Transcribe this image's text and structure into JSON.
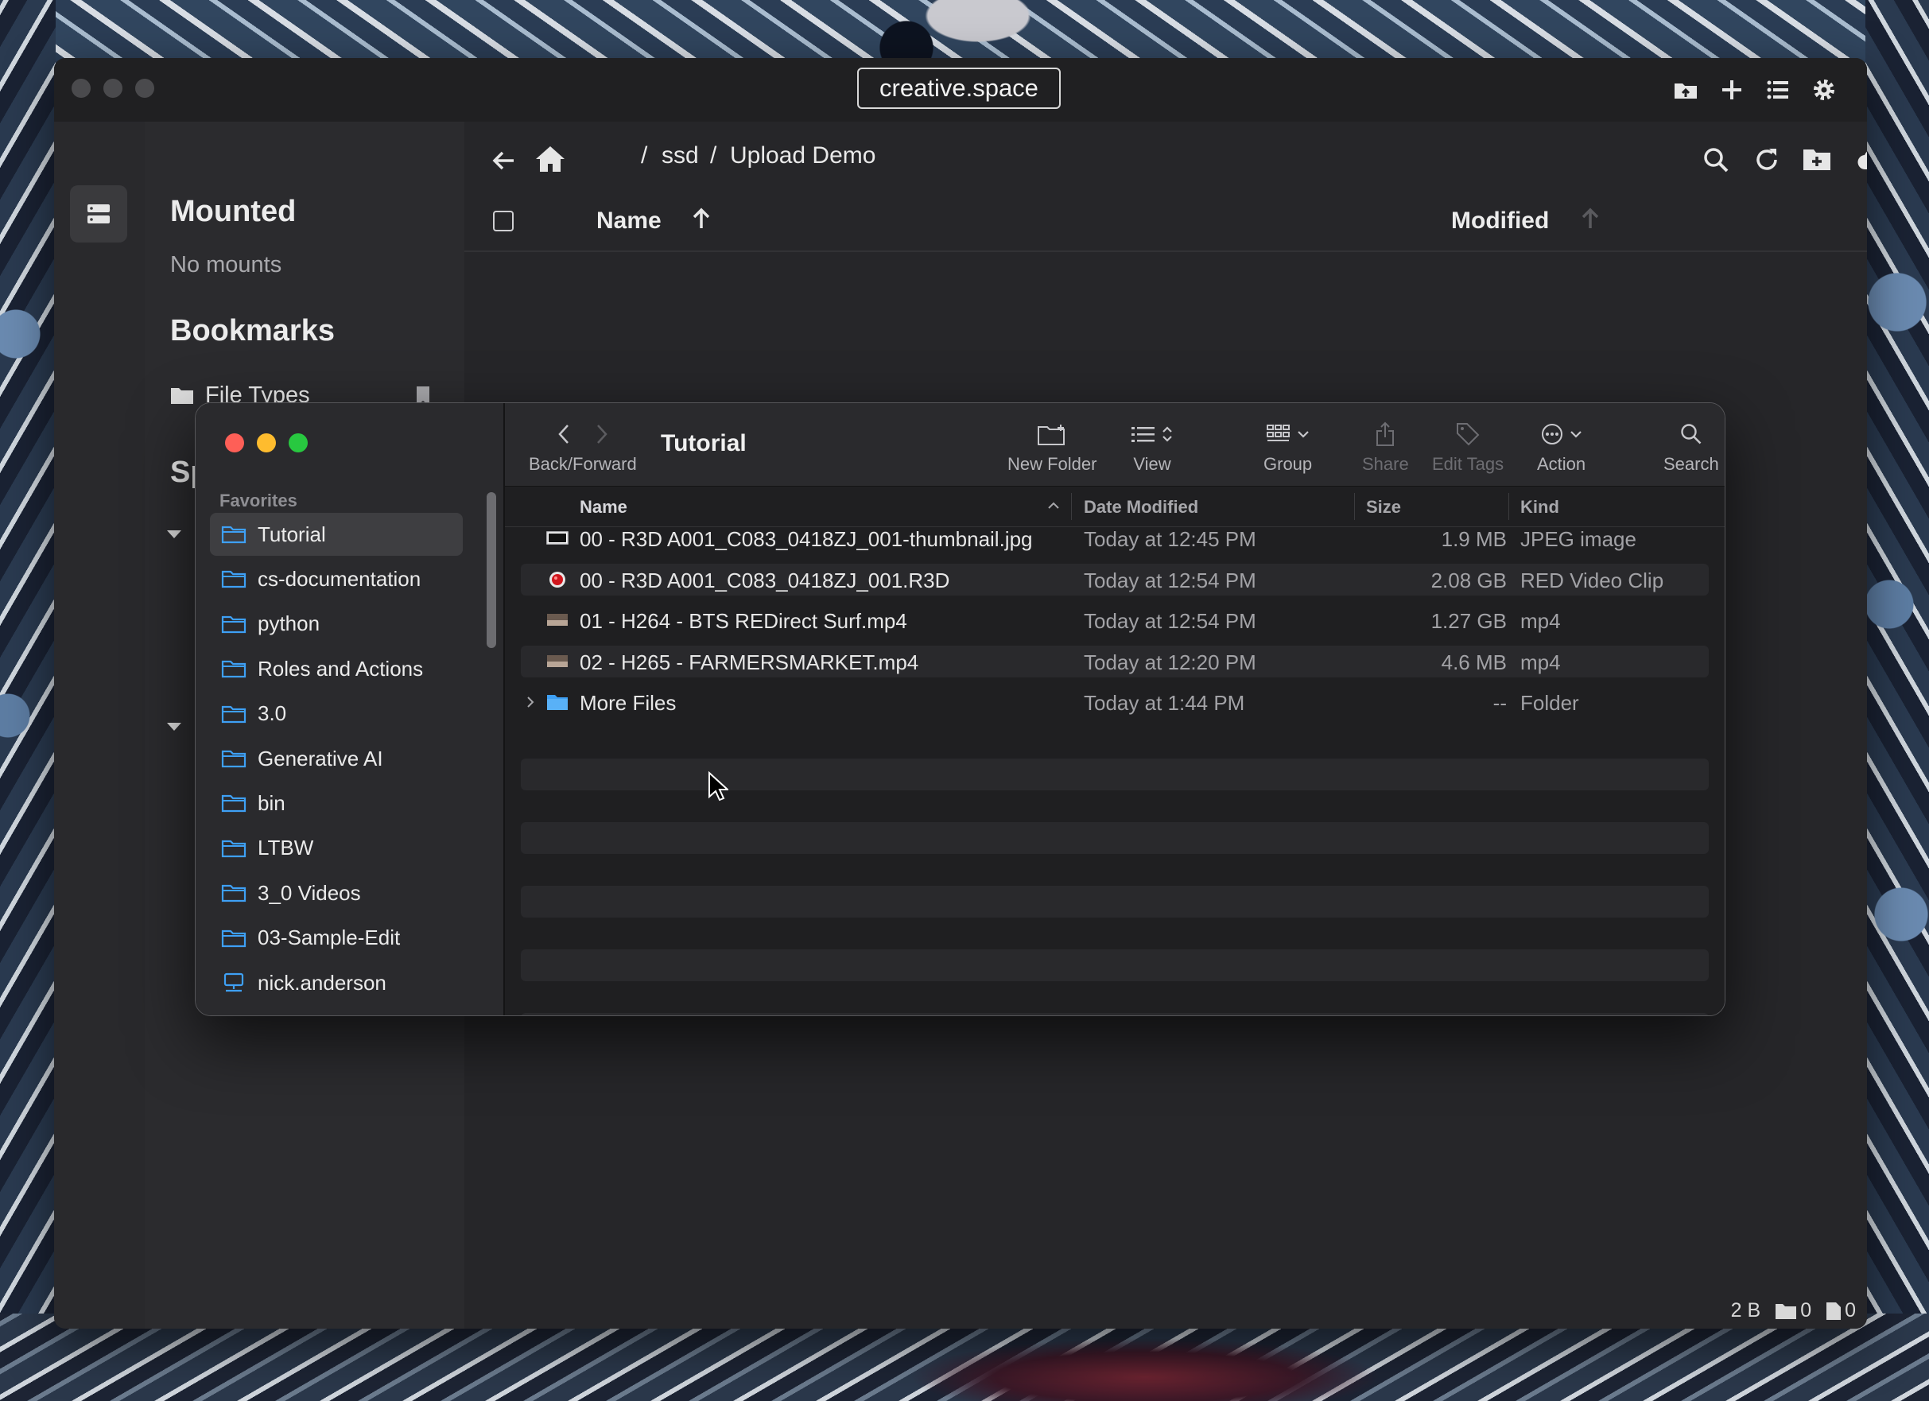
{
  "app": {
    "title": "creative.space",
    "sidebar": {
      "mounted_heading": "Mounted",
      "mounted_empty": "No mounts",
      "bookmarks_heading": "Bookmarks",
      "bookmarks": [
        {
          "label": "File Types"
        }
      ],
      "partial_heading": "Sp"
    },
    "breadcrumb": [
      "ssd",
      "Upload Demo"
    ],
    "columns": {
      "name": "Name",
      "modified": "Modified"
    },
    "status": {
      "size": "2 B",
      "folders": "0",
      "files": "0"
    }
  },
  "finder": {
    "title": "Tutorial",
    "favorites_label": "Favorites",
    "favorites": [
      {
        "label": "Tutorial",
        "selected": true,
        "icon": "folder-icon"
      },
      {
        "label": "cs-documentation",
        "icon": "folder-icon"
      },
      {
        "label": "python",
        "icon": "folder-icon"
      },
      {
        "label": "Roles and Actions",
        "icon": "folder-icon"
      },
      {
        "label": "3.0",
        "icon": "folder-icon"
      },
      {
        "label": "Generative AI",
        "icon": "folder-icon"
      },
      {
        "label": "bin",
        "icon": "folder-icon"
      },
      {
        "label": "LTBW",
        "icon": "folder-icon"
      },
      {
        "label": "3_0 Videos",
        "icon": "folder-icon"
      },
      {
        "label": "03-Sample-Edit",
        "icon": "folder-icon"
      },
      {
        "label": "nick.anderson",
        "icon": "home-network-icon"
      }
    ],
    "toolbar": {
      "back_forward": "Back/Forward",
      "new_folder": "New Folder",
      "view": "View",
      "group": "Group",
      "share": "Share",
      "edit_tags": "Edit Tags",
      "action": "Action",
      "search": "Search"
    },
    "columns": {
      "name": "Name",
      "date": "Date Modified",
      "size": "Size",
      "kind": "Kind"
    },
    "files": [
      {
        "name": "00 - R3D A001_C083_0418ZJ_001-thumbnail.jpg",
        "date": "Today at 12:45 PM",
        "size": "1.9 MB",
        "kind": "JPEG image"
      },
      {
        "name": "00 - R3D A001_C083_0418ZJ_001.R3D",
        "date": "Today at 12:54 PM",
        "size": "2.08 GB",
        "kind": "RED Video Clip"
      },
      {
        "name": "01 - H264 - BTS REDirect Surf.mp4",
        "date": "Today at 12:54 PM",
        "size": "1.27 GB",
        "kind": "mp4"
      },
      {
        "name": "02 - H265 - FARMERSMARKET.mp4",
        "date": "Today at 12:20 PM",
        "size": "4.6 MB",
        "kind": "mp4"
      },
      {
        "name": "More Files",
        "date": "Today at 1:44 PM",
        "size": "--",
        "kind": "Folder"
      }
    ],
    "colors": {
      "folder": "#3ea0f5",
      "close": "#fe5f57",
      "minimize": "#febc2e",
      "zoom": "#28c840"
    }
  }
}
